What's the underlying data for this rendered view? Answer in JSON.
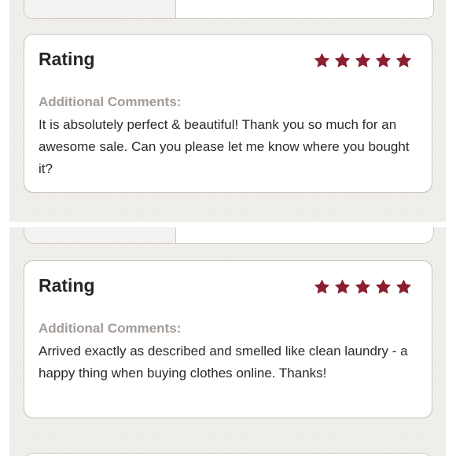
{
  "reviews": [
    {
      "rating_title": "Rating",
      "stars": 5,
      "star_color": "#8a1f2f",
      "comments_label": "Additional Comments:",
      "comment": "It is absolutely perfect & beautiful! Thank you so much for an awesome sale. Can you please let me know where you bought it?"
    },
    {
      "rating_title": "Rating",
      "stars": 5,
      "star_color": "#8a1f2f",
      "comments_label": "Additional Comments:",
      "comment": "Arrived exactly as described and smelled like clean laundry - a happy thing when buying clothes online. Thanks!"
    }
  ]
}
